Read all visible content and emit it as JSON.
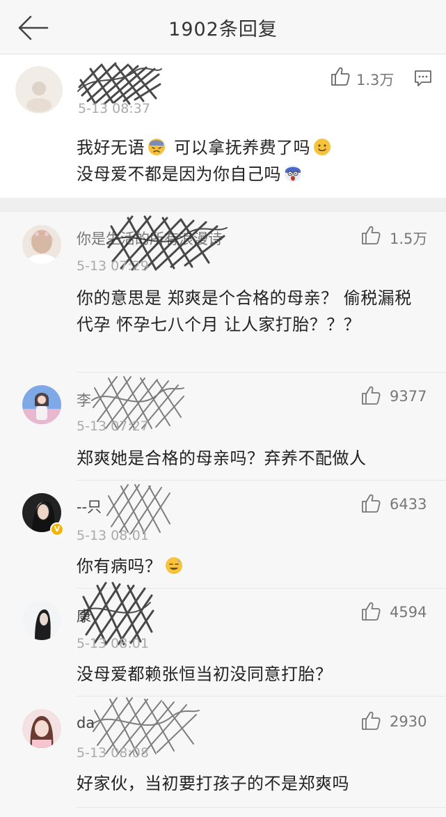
{
  "header": {
    "title": "1902条回复"
  },
  "main_comment": {
    "username": "",
    "time": "5-13 08:37",
    "likes": "1.3万",
    "line1_a": "我好无语",
    "line1_b": "可以拿抚养费了吗",
    "line2": "没母爱不都是因为你自己吗"
  },
  "replies": [
    {
      "username": "你是生活的所有浪漫诗",
      "time": "5-13 07:29",
      "likes": "1.5万",
      "text": "你的意思是 郑爽是个合格的母亲？ 偷税漏税 代孕 怀孕七八个月 让人家打胎？？？"
    },
    {
      "username": "李",
      "time": "5-13 07:27",
      "likes": "9377",
      "text": "郑爽她是合格的母亲吗？弃养不配做人"
    },
    {
      "username": "--只",
      "time": "5-13 08:01",
      "likes": "6433",
      "text": "你有病吗？"
    },
    {
      "username": "康",
      "time": "5-13 08:01",
      "likes": "4594",
      "text": "没母爱都赖张恒当初没同意打胎？"
    },
    {
      "username": "da",
      "time": "5-13 08:08",
      "likes": "2930",
      "text": "好家伙，当初要打孩子的不是郑爽吗"
    }
  ],
  "colors": {
    "background": "#f7f7f7",
    "main_bg": "#ffffff",
    "text": "#222222",
    "meta": "#aaaaaa"
  },
  "icons": [
    "back-arrow-icon",
    "like-icon",
    "comment-icon",
    "emoji-sweat-icon",
    "emoji-smile-icon",
    "emoji-scared-icon",
    "emoji-sweat-smile-icon"
  ]
}
